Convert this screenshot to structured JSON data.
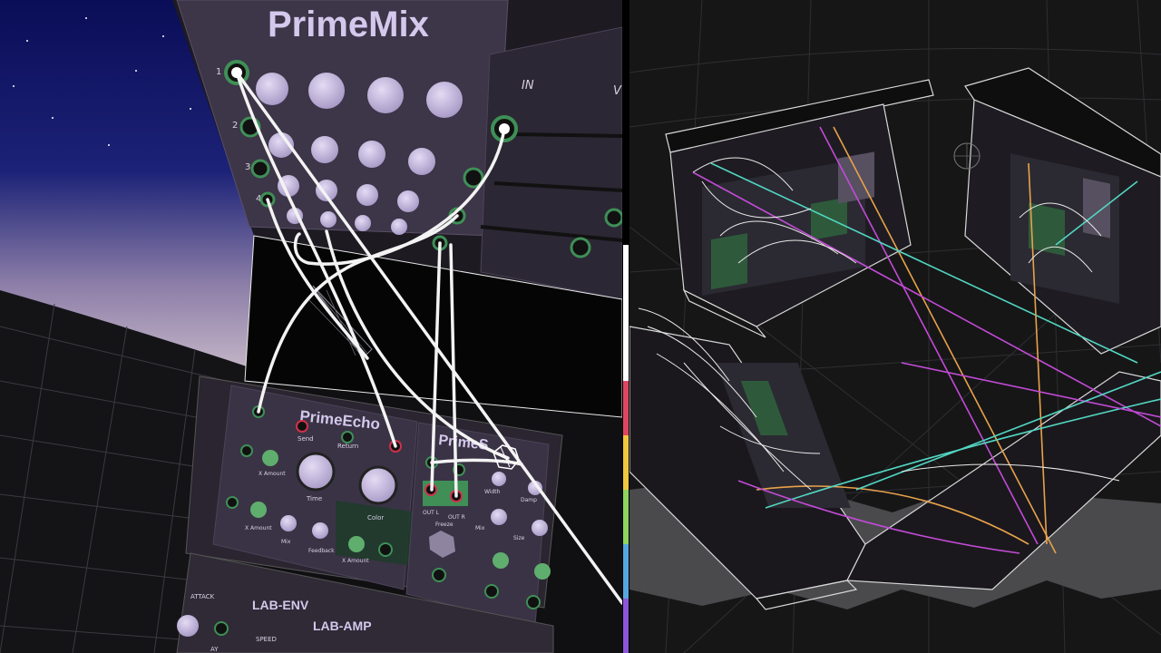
{
  "scene": {
    "left_view": "first-person rack view",
    "right_view": "overview of rack room"
  },
  "modules": {
    "primemix": {
      "title": "PrimeMix",
      "channel_numbers": [
        "1",
        "2",
        "3",
        "4"
      ],
      "label_in": "IN",
      "label_v": "V"
    },
    "primeecho": {
      "title": "PrimeEcho",
      "labels": {
        "send": "Send",
        "return": "Return",
        "amount1": "X Amount",
        "time": "Time",
        "color": "Color",
        "amount2": "X Amount",
        "mix": "Mix",
        "feedback": "Feedback",
        "amount3": "X Amount"
      }
    },
    "primeverb": {
      "title": "PrimeS",
      "labels": {
        "out_l": "OUT L",
        "out_r": "OUT R",
        "width": "Width",
        "damp": "Damp",
        "freeze": "Freeze",
        "mix": "Mix",
        "size": "Size"
      }
    },
    "lab_env": {
      "title": "LAB-ENV",
      "attack": "ATTACK",
      "speed": "SPEED",
      "decay_partial": "AY"
    },
    "lab_amp": {
      "title": "LAB-AMP"
    }
  },
  "colors": {
    "panel": "#3a3345",
    "panel_dark": "#26212e",
    "knob": "#c8bce0",
    "jack_ring": "#3f8f57",
    "accent_green": "#5fae6e",
    "cable_white": "#f2f2f2",
    "sky_top": "#0d0f55",
    "sky_bottom": "#b9a9c4",
    "cable_pink": "#c24bd6",
    "cable_cyan": "#52d6c2",
    "cable_orange": "#e8a24a"
  },
  "divider_colors": [
    "#ffffff",
    "#e04560",
    "#f0c640",
    "#8fd460",
    "#55a6e0",
    "#8c55d9"
  ],
  "icons": [
    "jack-icon",
    "knob-icon",
    "hand-cursor-icon"
  ]
}
